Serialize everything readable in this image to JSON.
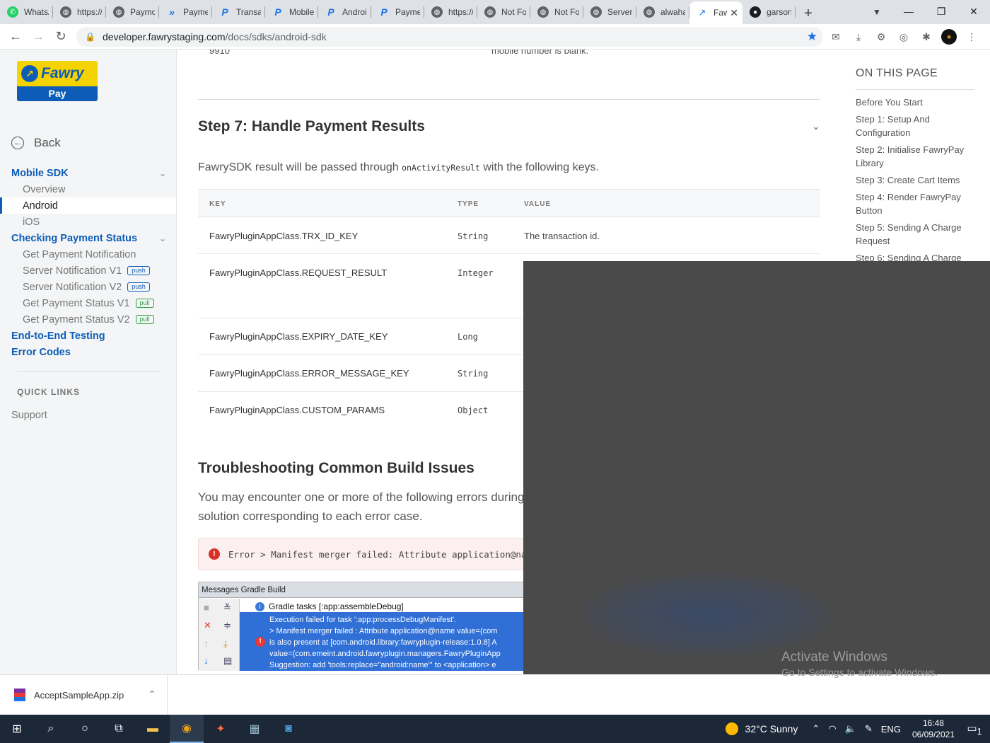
{
  "browser": {
    "tabs": [
      {
        "title": "WhatsApp",
        "icon": "whatsapp-icon",
        "active": false
      },
      {
        "title": "https://",
        "icon": "globe-icon",
        "active": false
      },
      {
        "title": "Paymob",
        "icon": "globe-icon",
        "active": false
      },
      {
        "title": "Payment",
        "icon": "paymob-icon",
        "active": false
      },
      {
        "title": "Transaction",
        "icon": "paypal-icon",
        "active": false
      },
      {
        "title": "Mobile",
        "icon": "paypal-icon",
        "active": false
      },
      {
        "title": "Android",
        "icon": "paypal-icon",
        "active": false
      },
      {
        "title": "Payment",
        "icon": "paypal-icon",
        "active": false
      },
      {
        "title": "https://",
        "icon": "globe-icon",
        "active": false
      },
      {
        "title": "Not Found",
        "icon": "globe-icon",
        "active": false
      },
      {
        "title": "Not Found",
        "icon": "globe-icon",
        "active": false
      },
      {
        "title": "Server",
        "icon": "globe-icon",
        "active": false
      },
      {
        "title": "alwaha",
        "icon": "globe-icon",
        "active": false
      },
      {
        "title": "Fawry",
        "icon": "fawry-icon",
        "active": true
      },
      {
        "title": "garson",
        "icon": "github-icon",
        "active": false
      }
    ],
    "url_host": "developer.fawrystaging.com",
    "url_path": "/docs/sdks/android-sdk"
  },
  "sidebar": {
    "logo_top": "Fawry",
    "logo_bottom": "Pay",
    "back_label": "Back",
    "mobile_sdk": "Mobile SDK",
    "overview": "Overview",
    "android": "Android",
    "ios": "iOS",
    "checking": "Checking Payment Status",
    "items": [
      {
        "label": "Get Payment Notification",
        "badge": ""
      },
      {
        "label": "Server Notification V1",
        "badge": "push"
      },
      {
        "label": "Server Notification V2",
        "badge": "push"
      },
      {
        "label": "Get Payment Status V1",
        "badge": "pull"
      },
      {
        "label": "Get Payment Status V2",
        "badge": "pull"
      }
    ],
    "e2e": "End-to-End Testing",
    "error_codes": "Error Codes",
    "quick_links": "QUICK LINKS",
    "support": "Support"
  },
  "main": {
    "cut_left": "9910",
    "cut_right": "mobile number is blank.",
    "step_title": "Step 7: Handle Payment Results",
    "lead_before": "FawrySDK result will be passed through ",
    "lead_code": "onActivityResult",
    "lead_after": " with the following keys.",
    "table": {
      "headers": [
        "KEY",
        "TYPE",
        "VALUE"
      ],
      "rows": [
        {
          "key": "FawryPluginAppClass.TRX_ID_KEY",
          "type": "String",
          "value": "The transaction id."
        },
        {
          "key": "FawryPluginAppClass.REQUEST_RESULT",
          "type": "Integer",
          "value": ""
        },
        {
          "key": "FawryPluginAppClass.EXPIRY_DATE_KEY",
          "type": "Long",
          "value": ""
        },
        {
          "key": "FawryPluginAppClass.ERROR_MESSAGE_KEY",
          "type": "String",
          "value": ""
        },
        {
          "key": "FawryPluginAppClass.CUSTOM_PARAMS",
          "type": "Object",
          "value": ""
        }
      ]
    },
    "troubleshoot_title": "Troubleshooting Common Build Issues",
    "troubleshoot_p": "You may encounter one or more of the following errors during",
    "troubleshoot_p2": "solution corresponding to each error case.",
    "error_text": "Error > Manifest merger failed: Attribute application@name",
    "gradle": {
      "header": "Messages Gradle Build",
      "task": "Gradle tasks [:app:assembleDebug]",
      "lines": [
        "Execution failed for task ':app:processDebugManifest'.",
        "> Manifest merger failed : Attribute application@name value=(com",
        "  is also present at [com.android.library:fawryplugin-release:1.0.8] A",
        "value=(com.emeint.android.fawryplugin.managers.FawryPluginApp",
        "  Suggestion: add 'tools:replace=\"android:name\"' to <application> e"
      ]
    }
  },
  "toc": {
    "title": "ON THIS PAGE",
    "items": [
      "Before You Start",
      "Step 1: Setup And Configuration",
      "Step 2: Initialise FawryPay Library",
      "Step 3: Create Cart Items",
      "Step 4: Render FawryPay Button",
      "Step 5: Sending A Charge Request",
      "Step 6: Sending A Charge"
    ]
  },
  "activate": {
    "title": "Activate Windows",
    "subtitle": "Go to Settings to activate Windows."
  },
  "download": {
    "filename": "AcceptSampleApp.zip"
  },
  "taskbar": {
    "weather": "32°C  Sunny",
    "lang": "ENG",
    "time": "16:48",
    "date": "06/09/2021",
    "notif_count": "1"
  }
}
